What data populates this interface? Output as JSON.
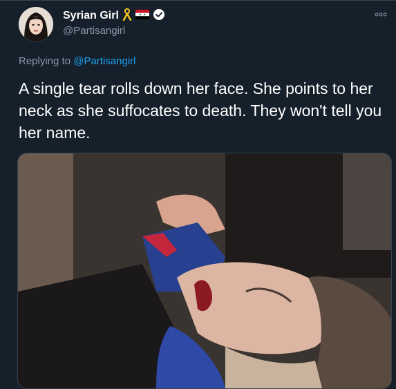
{
  "tweet": {
    "author": {
      "display_name": "Syrian Girl",
      "handle": "@Partisangirl",
      "verified": true,
      "badges": [
        "yellow-ribbon-icon",
        "syria-flag-icon",
        "verified-icon"
      ]
    },
    "reply": {
      "prefix": "Replying to ",
      "handle": "@Partisangirl"
    },
    "text": "A single tear rolls down her face. She points to her neck as she suffocates to death. They won't tell you her name.",
    "media": {
      "type": "video-still"
    },
    "more_icon": "more-options-icon"
  },
  "colors": {
    "background": "#15202b",
    "text": "#ffffff",
    "muted": "#8899a6",
    "link": "#1da1f2",
    "border": "#38444d"
  }
}
